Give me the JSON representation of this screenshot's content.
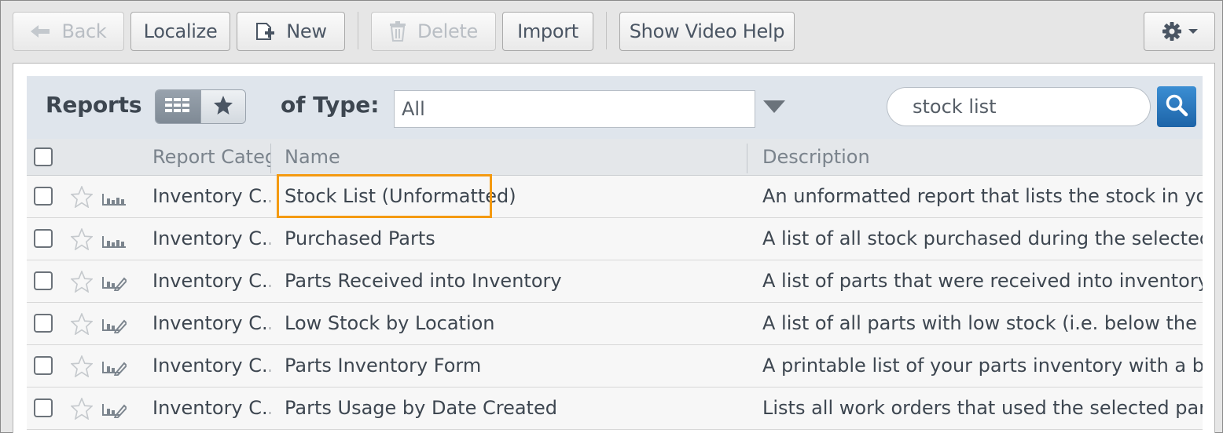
{
  "toolbar": {
    "back_label": "Back",
    "localize_label": "Localize",
    "new_label": "New",
    "delete_label": "Delete",
    "import_label": "Import",
    "video_help_label": "Show Video Help"
  },
  "header": {
    "title": "Reports",
    "of_type_label": "of Type:",
    "type_value": "All",
    "search_value": "stock list"
  },
  "table": {
    "columns": [
      "Report Category",
      "Name",
      "Description"
    ],
    "rows": [
      {
        "category": "Inventory C...",
        "name": "Stock List (Unformatted)",
        "description": "An unformatted report that lists the stock in your CMMS",
        "icon": "chart-icon"
      },
      {
        "category": "Inventory C...",
        "name": "Purchased Parts",
        "description": "A list of all stock purchased during the selected time per",
        "icon": "chart-icon"
      },
      {
        "category": "Inventory C...",
        "name": "Parts Received into Inventory",
        "description": "A list of parts that were received into inventory during th",
        "icon": "chart-edit-icon"
      },
      {
        "category": "Inventory C...",
        "name": "Low Stock by Location",
        "description": "A list of all parts with low stock (i.e. below the minimum",
        "icon": "chart-edit-icon"
      },
      {
        "category": "Inventory C...",
        "name": "Parts Inventory Form",
        "description": "A printable list of your parts inventory with a blank colu",
        "icon": "chart-edit-icon"
      },
      {
        "category": "Inventory C...",
        "name": "Parts Usage by Date Created",
        "description": "Lists all work orders that used the selected part betweer",
        "icon": "chart-edit-icon"
      }
    ]
  },
  "colors": {
    "highlight": "#f49a11",
    "search_button": "#2a78c0"
  }
}
